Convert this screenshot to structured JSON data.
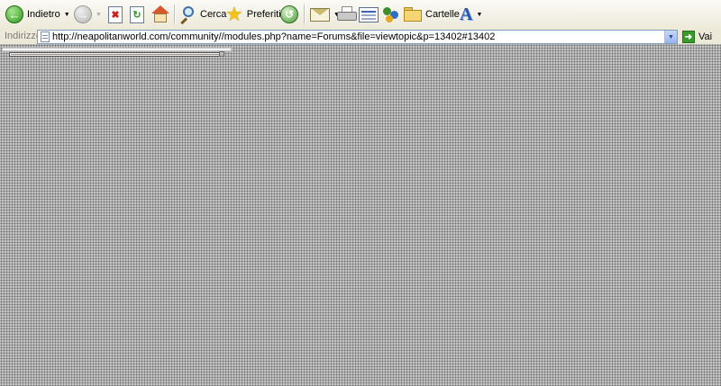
{
  "toolbar": {
    "back_label": "Indietro",
    "search_label": "Cerca",
    "favorites_label": "Preferiti",
    "folders_label": "Cartelle",
    "icons": [
      "back-icon",
      "forward-icon",
      "stop-icon",
      "refresh-icon",
      "home-icon",
      "search-icon",
      "favorites-icon",
      "history-icon",
      "mail-icon",
      "print-icon",
      "edit-icon",
      "messenger-icon",
      "folders-icon",
      "font-icon"
    ]
  },
  "address_bar": {
    "label": "Indirizzo",
    "url": "http://neapolitanworld.com/community//modules.php?name=Forums&file=viewtopic&p=13402#13402",
    "go_label": "Vai"
  },
  "colors": {
    "content_background": "#c7c7c7",
    "toolbar_background": "#ece9d8",
    "accent_green": "#2f9a1f"
  }
}
